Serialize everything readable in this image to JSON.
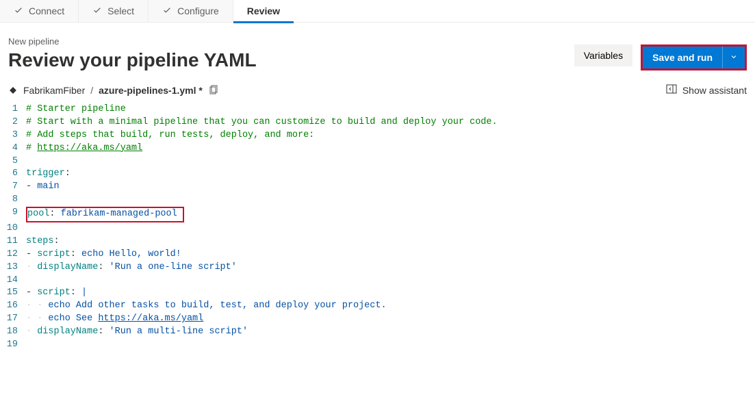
{
  "wizard": {
    "steps": [
      {
        "label": "Connect",
        "done": true
      },
      {
        "label": "Select",
        "done": true
      },
      {
        "label": "Configure",
        "done": true
      },
      {
        "label": "Review",
        "active": true
      }
    ]
  },
  "header": {
    "breadcrumb": "New pipeline",
    "title": "Review your pipeline YAML",
    "variables_label": "Variables",
    "save_run_label": "Save and run"
  },
  "subbar": {
    "repo": "FabrikamFiber",
    "filename": "azure-pipelines-1.yml *",
    "show_assistant_label": "Show assistant"
  },
  "editor": {
    "lines": [
      {
        "n": 1,
        "t": "comment",
        "text": "# Starter pipeline"
      },
      {
        "n": 2,
        "t": "comment",
        "text": "# Start with a minimal pipeline that you can customize to build and deploy your code."
      },
      {
        "n": 3,
        "t": "comment",
        "text": "# Add steps that build, run tests, deploy, and more:"
      },
      {
        "n": 4,
        "t": "comment-link",
        "prefix": "# ",
        "url": "https://aka.ms/yaml"
      },
      {
        "n": 5,
        "t": "blank"
      },
      {
        "n": 6,
        "t": "kv",
        "key": "trigger",
        "val": ""
      },
      {
        "n": 7,
        "t": "item",
        "val": "main"
      },
      {
        "n": 8,
        "t": "blank"
      },
      {
        "n": 9,
        "t": "kv",
        "key": "pool",
        "val": "fabrikam-managed-pool",
        "highlight": true
      },
      {
        "n": 10,
        "t": "blank"
      },
      {
        "n": 11,
        "t": "kv",
        "key": "steps",
        "val": ""
      },
      {
        "n": 12,
        "t": "item-kv",
        "key": "script",
        "val": "echo Hello, world!"
      },
      {
        "n": 13,
        "t": "sub-kv",
        "key": "displayName",
        "val": "'Run a one-line script'"
      },
      {
        "n": 14,
        "t": "blank"
      },
      {
        "n": 15,
        "t": "item-kv",
        "key": "script",
        "val": "|"
      },
      {
        "n": 16,
        "t": "block",
        "val": "echo Add other tasks to build, test, and deploy your project."
      },
      {
        "n": 17,
        "t": "block-url",
        "prefix": "echo See ",
        "url": "https://aka.ms/yaml"
      },
      {
        "n": 18,
        "t": "sub-kv",
        "key": "displayName",
        "val": "'Run a multi-line script'"
      },
      {
        "n": 19,
        "t": "blank"
      }
    ]
  }
}
